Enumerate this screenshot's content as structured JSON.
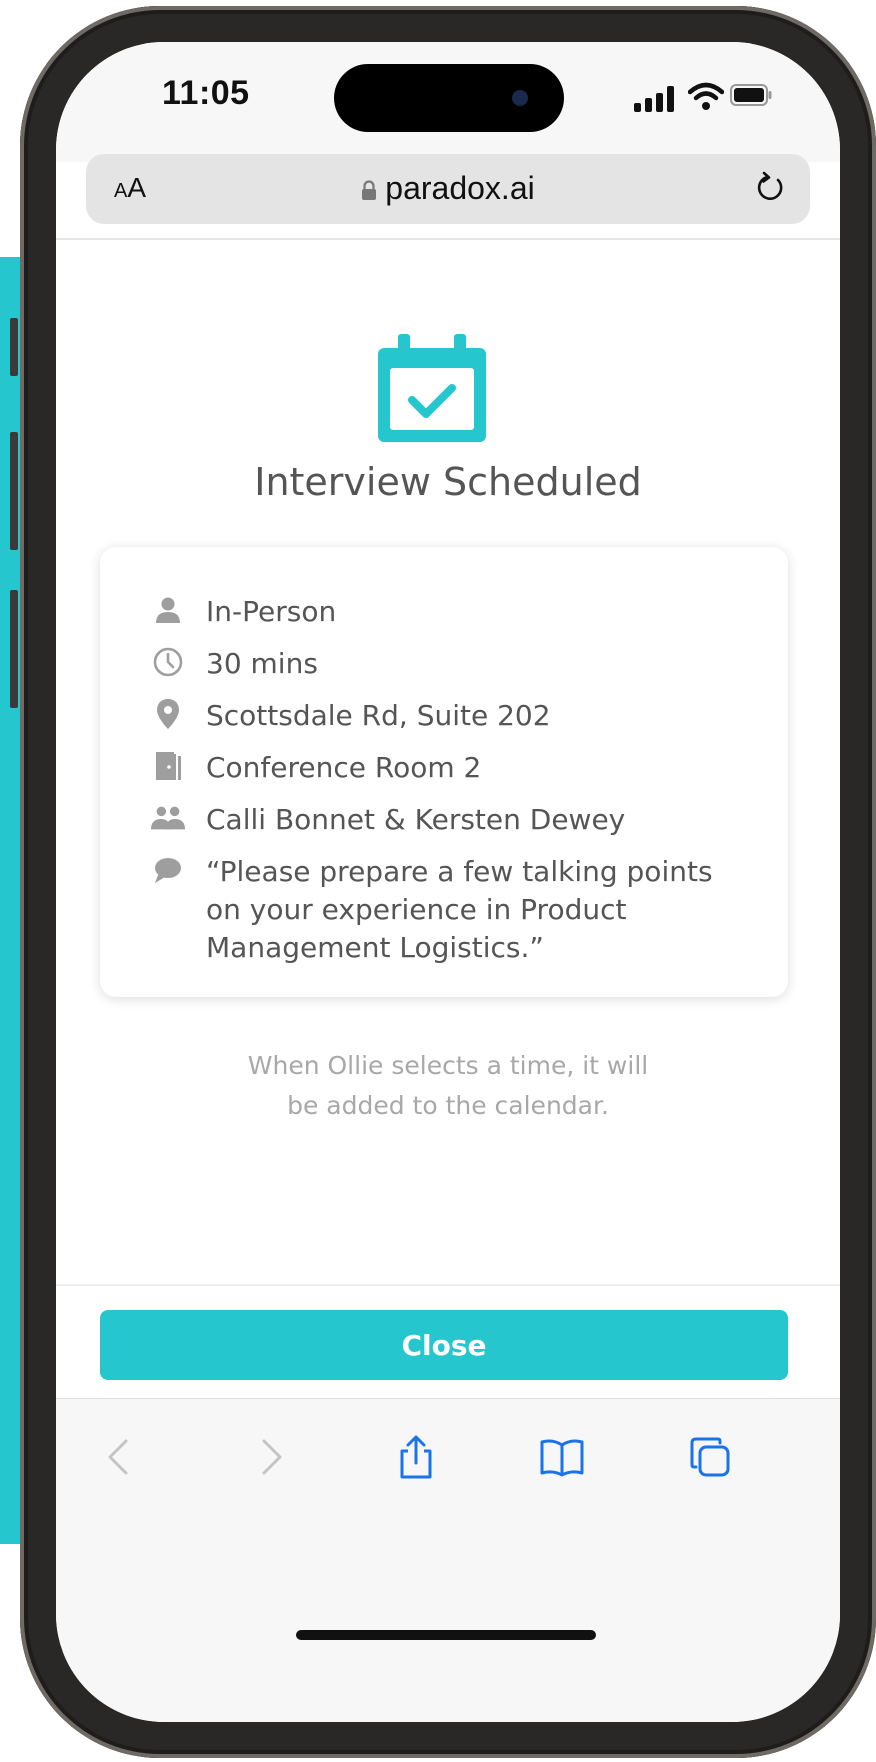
{
  "status_bar": {
    "time": "11:05"
  },
  "browser": {
    "text_size_label_small": "A",
    "text_size_label_large": "A",
    "url": "paradox.ai"
  },
  "page": {
    "title": "Interview Scheduled",
    "details": [
      {
        "icon": "person-icon",
        "text": "In-Person"
      },
      {
        "icon": "clock-icon",
        "text": "30 mins"
      },
      {
        "icon": "location-pin-icon",
        "text": "Scottsdale Rd, Suite 202"
      },
      {
        "icon": "door-icon",
        "text": "Conference Room 2"
      },
      {
        "icon": "people-icon",
        "text": "Calli Bonnet & Kersten Dewey"
      },
      {
        "icon": "speech-bubble-icon",
        "text": "“Please prepare a few talking points on your experience in Product Management Logistics.”"
      }
    ],
    "note_line1": "When Ollie selects a time, it will",
    "note_line2": "be added to the calendar.",
    "close_label": "Close"
  },
  "colors": {
    "accent": "#26c6cf",
    "text": "#555555",
    "muted": "#a8a8a8",
    "icon": "#9e9e9e"
  }
}
